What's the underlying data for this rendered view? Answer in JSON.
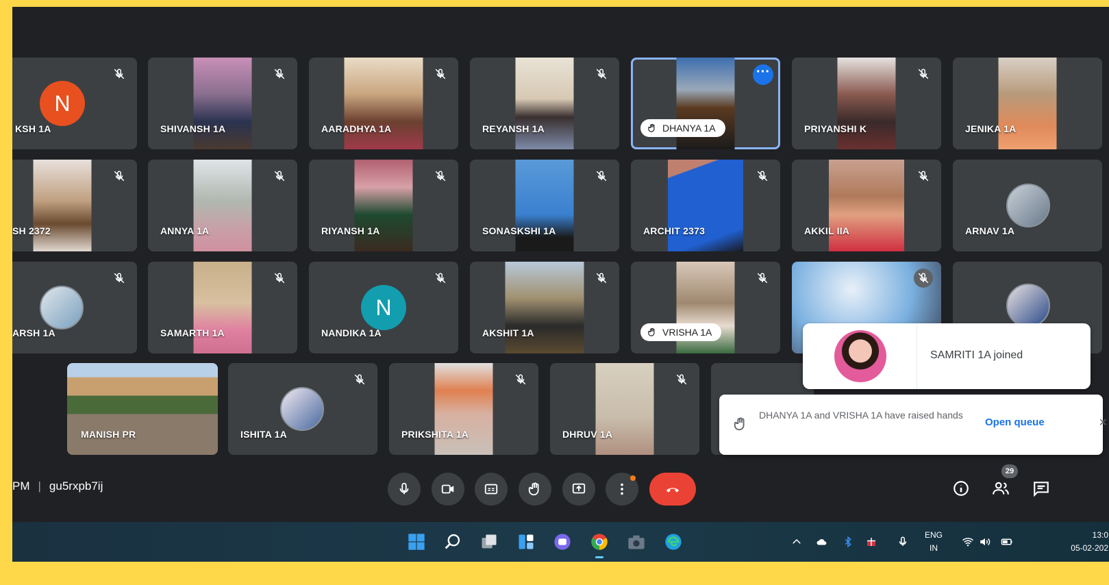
{
  "grid": {
    "row1": [
      {
        "name": "KSH 1A",
        "avatar_letter": "N",
        "avatar_color": "#e8501f"
      },
      {
        "name": "SHIVANSH 1A"
      },
      {
        "name": "AARADHYA 1A"
      },
      {
        "name": "REYANSH 1A"
      },
      {
        "name": "DHANYA 1A",
        "hand_raised": true
      },
      {
        "name": "PRIYANSHI K"
      },
      {
        "name": "JENIKA 1A"
      }
    ],
    "row2": [
      {
        "name": "SH 2372"
      },
      {
        "name": "ANNYA 1A"
      },
      {
        "name": "RIYANSH 1A"
      },
      {
        "name": "SONASKSHI 1A"
      },
      {
        "name": "ARCHIT 2373"
      },
      {
        "name": "AKKIL IIA"
      },
      {
        "name": "ARNAV 1A"
      }
    ],
    "row3": [
      {
        "name": "ARSH 1A"
      },
      {
        "name": "SAMARTH 1A"
      },
      {
        "name": "NANDIKA 1A",
        "avatar_letter": "N",
        "avatar_color": "#129eaf"
      },
      {
        "name": "AKSHIT 1A"
      },
      {
        "name": "VRISHA 1A",
        "hand_raised": true
      }
    ],
    "row4": [
      {
        "name": "MANISH PR"
      },
      {
        "name": "ISHITA 1A"
      },
      {
        "name": "PRIKSHITA 1A"
      },
      {
        "name": "DHRUV 1A"
      }
    ]
  },
  "toasts": {
    "joined": "SAMRITI 1A joined",
    "raised_hands": "DHANYA 1A and VRISHA 1A have raised hands",
    "open_queue": "Open queue",
    "close": "×"
  },
  "meeting": {
    "time": "PM",
    "separator": "|",
    "code": "gu5rxpb7ij"
  },
  "controls": {
    "icons": [
      "mic-icon",
      "camera-icon",
      "captions-icon",
      "raise-hand-icon",
      "present-icon",
      "more-options-icon",
      "end-call-icon"
    ],
    "end_color": "#ea4335"
  },
  "right_panel": {
    "participants_count": "29",
    "icons": [
      "info-icon",
      "people-icon",
      "chat-icon"
    ]
  },
  "taskbar": {
    "lang_line1": "ENG",
    "lang_line2": "IN",
    "time": "13:0",
    "date": "05-02-202"
  },
  "colors": {
    "frame": "#ffd84a",
    "background": "#202124",
    "tile": "#3c4043",
    "active_outline": "#8ab4f8",
    "link": "#1a73e8"
  }
}
